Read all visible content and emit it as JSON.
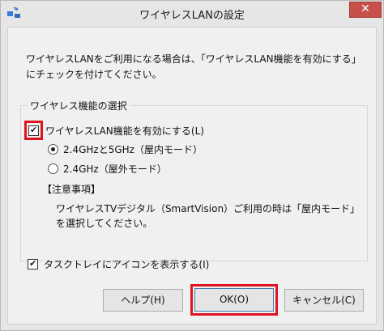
{
  "window": {
    "title": "ワイヤレスLANの設定",
    "close_label": "✕"
  },
  "description": {
    "line1": "ワイヤレスLANをご利用になる場合は、「ワイヤレスLAN機能を有効にする」",
    "line2": "にチェックを付けてください。"
  },
  "group": {
    "title": "ワイヤレス機能の選択",
    "enable_checkbox": {
      "label": "ワイヤレスLAN機能を有効にする(L)",
      "checked": true
    },
    "radios": [
      {
        "label": "2.4GHzと5GHz（屋内モード）",
        "selected": true
      },
      {
        "label": "2.4GHz（屋外モード）",
        "selected": false
      }
    ],
    "notes_heading": "【注意事項】",
    "notes_line1": "ワイヤレスTVデジタル（SmartVision）ご利用の時は「屋内モード」",
    "notes_line2": "を選択してください。"
  },
  "tasktray_checkbox": {
    "label": "タスクトレイにアイコンを表示する(I)",
    "checked": true
  },
  "buttons": {
    "help": "ヘルプ(H)",
    "ok": "OK(O)",
    "cancel": "キャンセル(C)"
  },
  "colors": {
    "highlight": "#e0141e",
    "close_button": "#c7504a"
  }
}
